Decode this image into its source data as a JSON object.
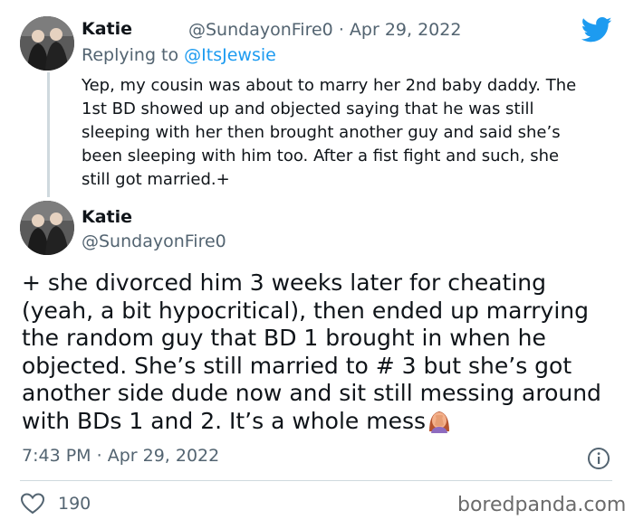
{
  "tweet1": {
    "author_name": "Katie",
    "author_handle": "@SundayonFire0",
    "separator": "·",
    "date": "Apr 29, 2022",
    "replying_prefix": "Replying to",
    "replying_handle": "@ItsJewsie",
    "lines": [
      "Yep, my cousin was about to marry her 2nd baby daddy. The",
      "1st BD showed up and objected saying that he was still",
      "sleeping with her then brought another guy and said she’s",
      "been sleeping with him too. After a fist fight and such, she",
      "still got married.+"
    ]
  },
  "tweet2": {
    "author_name": "Katie",
    "author_handle": "@SundayonFire0",
    "lines": [
      "+ she divorced him 3 weeks later for cheating",
      "(yeah, a bit hypocritical), then ended up marrying",
      "the random guy that BD 1 brought in when he",
      "objected. She’s still married to # 3 but she’s got",
      "another side dude now and sit still messing around",
      "with BDs 1 and 2. It’s a whole mess"
    ],
    "time": "7:43 PM",
    "separator": "·",
    "date": "Apr 29, 2022",
    "like_count": "190"
  },
  "watermark": "boredpanda.com",
  "icons": {
    "brand": "twitter-bird-icon",
    "info": "info-icon",
    "like": "heart-icon",
    "emoji": "woman-facepalming-icon"
  },
  "colors": {
    "twitter_blue": "#1d9bf0",
    "muted_text": "#536471",
    "thread_line": "#cfd9de"
  }
}
